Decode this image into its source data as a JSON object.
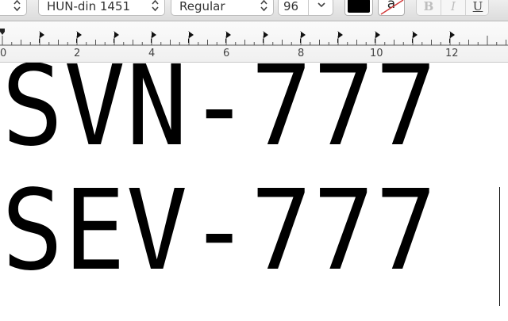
{
  "toolbar": {
    "font_family": "HUN-din 1451",
    "font_style": "Regular",
    "font_size": "96",
    "text_color": "#000000",
    "highlight_letter": "a",
    "bold_label": "B",
    "italic_label": "I",
    "underline_label": "U"
  },
  "ruler": {
    "labels": [
      "0",
      "2",
      "4",
      "6",
      "8",
      "10",
      "12"
    ]
  },
  "document": {
    "lines": [
      "SVN-777",
      "SEV-777"
    ]
  }
}
